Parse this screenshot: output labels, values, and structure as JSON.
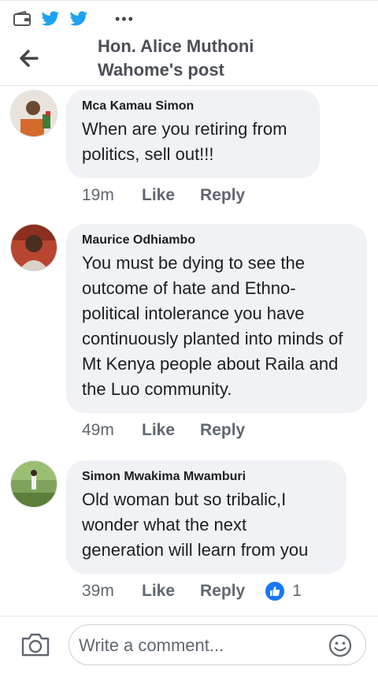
{
  "header": {
    "title": "Hon. Alice Muthoni Wahome's post"
  },
  "comments": [
    {
      "author": "Mca Kamau Simon",
      "text": "When are you retiring from politics, sell out!!!",
      "time": "19m",
      "like": "Like",
      "reply": "Reply"
    },
    {
      "author": "Maurice Odhiambo",
      "text": "You must be dying to see the outcome of hate and Ethno-political intolerance you have continuously planted into minds of Mt Kenya people about Raila and the Luo community.",
      "time": "49m",
      "like": "Like",
      "reply": "Reply"
    },
    {
      "author": "Simon Mwakima Mwamburi",
      "text": "Old woman but so tribalic,I wonder what the next generation will learn from you",
      "time": "39m",
      "like": "Like",
      "reply": "Reply",
      "reaction_count": "1"
    }
  ],
  "composer": {
    "placeholder": "Write a comment..."
  },
  "colors": {
    "accent": "#1877f2",
    "bubble": "#f0f2f5",
    "twitter": "#1da1f2"
  }
}
